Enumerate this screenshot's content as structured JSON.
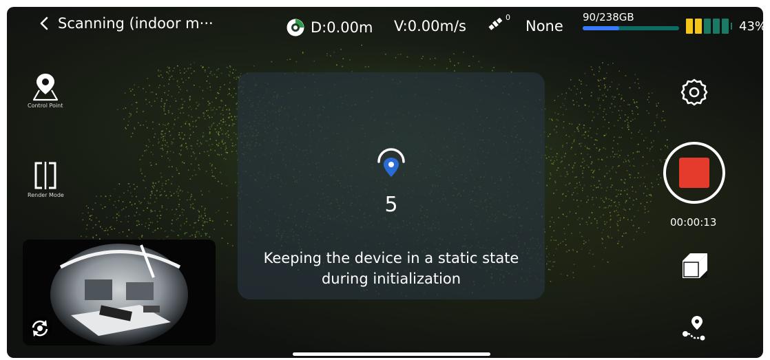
{
  "header": {
    "title": "Scanning (indoor m···",
    "distance": "D:0.00m",
    "velocity": "V:0.00m/s",
    "satellite_count": "0",
    "signal_status": "None",
    "storage": {
      "label": "90/238GB",
      "used_fraction": 0.378
    },
    "battery": {
      "percent": "43%",
      "level_fraction": 0.43
    }
  },
  "left_tools": {
    "control_point_label": "Control Point",
    "render_mode_label": "Render Mode"
  },
  "dialog": {
    "countdown": "5",
    "message": "Keeping the device in a static state during initialization"
  },
  "record": {
    "elapsed": "00:00:13"
  },
  "colors": {
    "record_red": "#e53b2c",
    "storage_fill": "#3a78ff",
    "storage_track": "#0c6c63",
    "battery_yellow": "#f5c518",
    "battery_green": "#1b7a66",
    "marker_blue": "#2b6bd6"
  },
  "icons": [
    "back-chevron-icon",
    "compass-icon",
    "satellite-icon",
    "control-point-icon",
    "render-mode-icon",
    "settings-icon",
    "record-icon",
    "cube-view-icon",
    "route-icon",
    "camera-switch-icon",
    "location-pin-icon"
  ]
}
